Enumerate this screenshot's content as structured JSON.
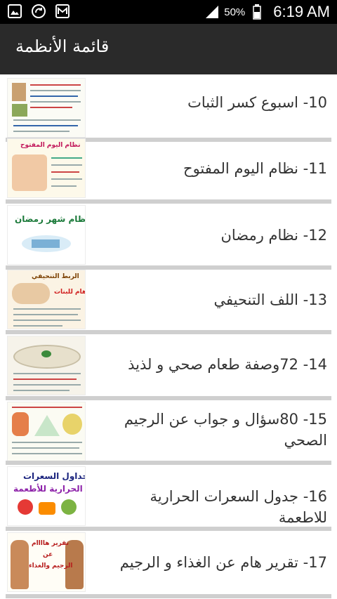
{
  "status_bar": {
    "battery_percent": "50%",
    "time": "6:19 AM",
    "icons": [
      "gallery-icon",
      "refresh-icon",
      "mail-icon",
      "signal-icon",
      "battery-icon"
    ]
  },
  "app_bar": {
    "title": "قائمة الأنظمة"
  },
  "list": {
    "items": [
      {
        "label": "10- اسبوع كسر الثبات",
        "thumb_text": []
      },
      {
        "label": "11- نظام اليوم المفتوح",
        "thumb_text": [
          "نظام اليوم المفتوح"
        ]
      },
      {
        "label": "12- نظام رمضان",
        "thumb_text": [
          "نظام شهر رمضان"
        ]
      },
      {
        "label": "13- اللف التنحيفي",
        "thumb_text": [
          "الربط التنحيفي",
          "هام للبنات"
        ]
      },
      {
        "label": "14- 72وصفة طعام صحي و لذيذ",
        "thumb_text": []
      },
      {
        "label": "15- 80سؤال و جواب عن الرجيم الصحي",
        "thumb_text": []
      },
      {
        "label": "16- جدول السعرات الحرارية للاطعمة",
        "thumb_text": [
          "جداول السعرات",
          "الحرارية للأطعمة"
        ]
      },
      {
        "label": "17- تقرير هام عن الغذاء و الرجيم",
        "thumb_text": [
          "تقرير هاااام",
          "عن",
          "الرجيم والغذاء"
        ]
      }
    ]
  },
  "colors": {
    "status_bar": "#000000",
    "app_bar": "#2a2a2a",
    "divider": "#cfcfcf",
    "text": "#333333"
  }
}
